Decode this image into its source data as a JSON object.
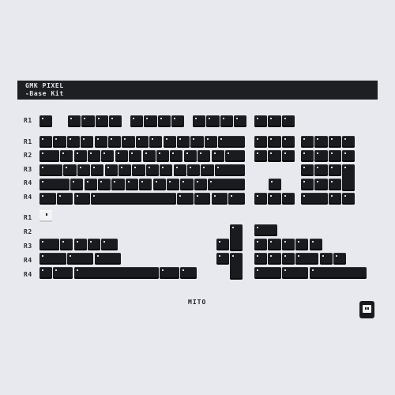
{
  "header": {
    "line1": "GMK PIXEL",
    "line2": "-Base Kit"
  },
  "row_labels": [
    "R1",
    "R1",
    "R2",
    "R3",
    "R4",
    "R4",
    "R1",
    "R2",
    "R3",
    "R4",
    "R4"
  ],
  "brand": "MITO",
  "colors": {
    "background": "#e7e9ee",
    "key": "#1a1b1f",
    "accent_key": "#f2f3f5",
    "title_bar": "#1e1f23"
  },
  "icons": {
    "mascot": "pixel-ghost-icon"
  }
}
